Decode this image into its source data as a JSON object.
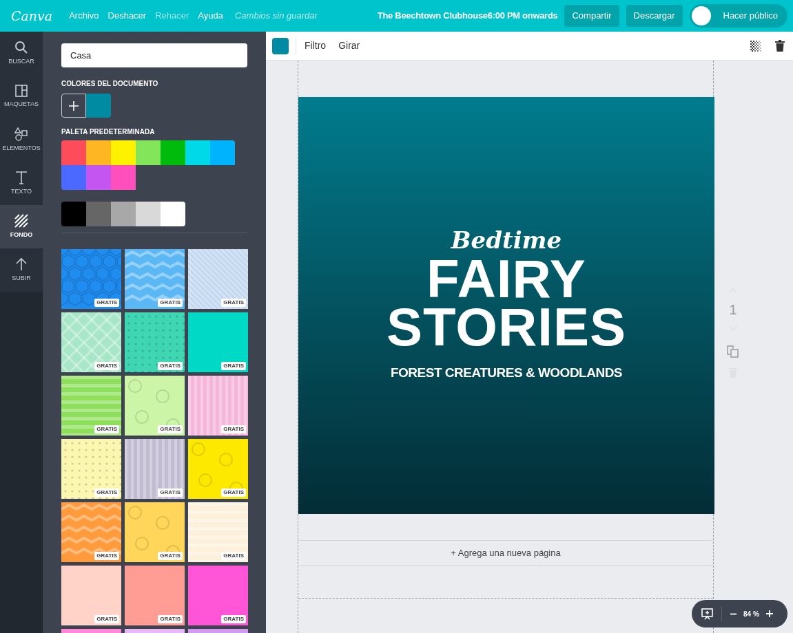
{
  "topbar": {
    "logo": "Canva",
    "menu": [
      {
        "label": "Archivo",
        "disabled": false
      },
      {
        "label": "Deshacer",
        "disabled": false
      },
      {
        "label": "Rehacer",
        "disabled": true
      },
      {
        "label": "Ayuda",
        "disabled": false
      }
    ],
    "save_status": "Cambios sin guardar",
    "title": "The Beechtown Clubhouse6:00 PM onwards",
    "buttons": [
      "Compartir",
      "Descargar"
    ],
    "public_toggle": {
      "label": "Hacer público",
      "on": false
    }
  },
  "rail": [
    {
      "label": "BUSCAR",
      "kind": "search",
      "selected": false
    },
    {
      "label": "MAQUETAS",
      "kind": "layouts",
      "selected": false
    },
    {
      "label": "ELEMENTOS",
      "kind": "elements",
      "selected": false
    },
    {
      "label": "TEXTO",
      "kind": "text",
      "selected": false
    },
    {
      "label": "FONDO",
      "kind": "background",
      "selected": true
    },
    {
      "label": "SUBIR",
      "kind": "upload",
      "selected": false
    }
  ],
  "panel": {
    "search": {
      "value": "Casa"
    },
    "document_colors": {
      "title": "COLORES DEL DOCUMENTO",
      "colors": [
        {
          "color": "#008ba3"
        }
      ]
    },
    "default_palette": {
      "title": "PALETA PREDETERMINADA",
      "colors": [
        {
          "color": "#ff4c5b"
        },
        {
          "color": "#ffb623"
        },
        {
          "color": "#fff200"
        },
        {
          "color": "#82e55a"
        },
        {
          "color": "#00bb0c"
        },
        {
          "color": "#00d9e8"
        },
        {
          "color": "#00b3fd"
        },
        {
          "color": "#4b69ff"
        },
        {
          "color": "#c455f0"
        },
        {
          "color": "#ff4fbd"
        }
      ],
      "grays": [
        {
          "color": "#000000"
        },
        {
          "color": "#666666"
        },
        {
          "color": "#a8a8a8"
        },
        {
          "color": "#d9d9d9"
        },
        {
          "color": "#ffffff"
        }
      ]
    },
    "backgrounds": [
      {
        "kind": "hexagons",
        "color": "#1f8cf0",
        "badge": "GRATIS"
      },
      {
        "kind": "zigzag",
        "color": "#5cb8f5",
        "badge": "GRATIS"
      },
      {
        "kind": "diagonal",
        "color": "#c4d8f0",
        "badge": "GRATIS"
      },
      {
        "kind": "diamonds",
        "color": "#a8e6c8",
        "badge": "GRATIS"
      },
      {
        "kind": "dots",
        "color": "#3fd6b4",
        "badge": "GRATIS"
      },
      {
        "kind": "plain",
        "color": "#00d9c5",
        "badge": "GRATIS"
      },
      {
        "kind": "hstripes",
        "color": "#8ee05c",
        "badge": "GRATIS"
      },
      {
        "kind": "circles",
        "color": "#ccf5a8",
        "badge": "GRATIS"
      },
      {
        "kind": "vstripes",
        "color": "#f5b6dc",
        "badge": "GRATIS"
      },
      {
        "kind": "dots",
        "color": "#fcf7b0",
        "badge": "GRATIS"
      },
      {
        "kind": "vstripes",
        "color": "#c2bcd2",
        "badge": "GRATIS"
      },
      {
        "kind": "circles",
        "color": "#fde900",
        "badge": "GRATIS"
      },
      {
        "kind": "zigzag",
        "color": "#ff9b3c",
        "badge": "GRATIS"
      },
      {
        "kind": "circles",
        "color": "#ffd65a",
        "badge": "GRATIS"
      },
      {
        "kind": "hstripes",
        "color": "#fdf1dc",
        "badge": "GRATIS"
      },
      {
        "kind": "plain",
        "color": "#ffd3c8",
        "badge": "GRATIS"
      },
      {
        "kind": "plain",
        "color": "#ff9c94",
        "badge": "GRATIS"
      },
      {
        "kind": "plain",
        "color": "#ff55d6",
        "badge": "GRATIS"
      },
      {
        "kind": "plain",
        "color": "#ff88d8"
      },
      {
        "kind": "plain",
        "color": "#e8b8f4"
      },
      {
        "kind": "plain",
        "color": "#d49af0"
      }
    ]
  },
  "toolbar": {
    "color": "#008ba3",
    "actions": [
      "Filtro",
      "Girar"
    ]
  },
  "design": {
    "script_title": "Bedtime",
    "title_lines": [
      "FAIRY",
      "STORIES"
    ],
    "subtitle": "FOREST CREATURES & WOODLANDS"
  },
  "add_page": "+ Agrega una nueva página",
  "page_number": "1",
  "zoom": "84 %"
}
